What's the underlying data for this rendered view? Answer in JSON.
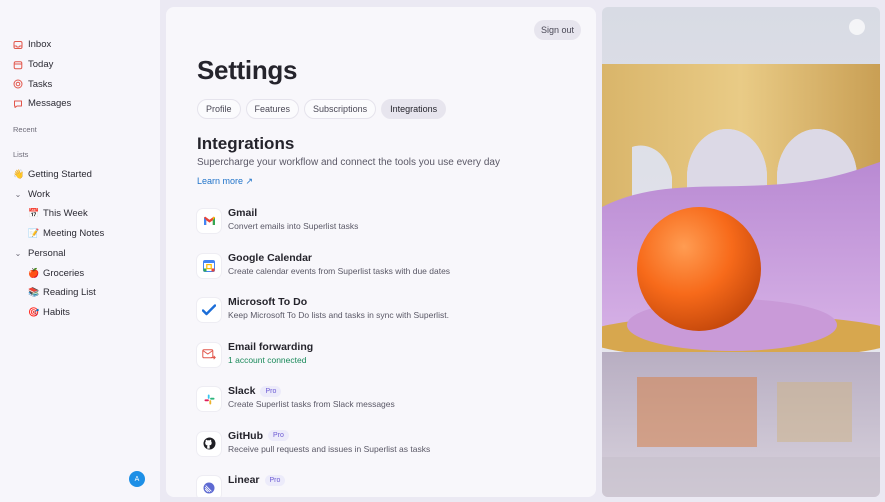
{
  "sidebar": {
    "nav": [
      {
        "label": "Inbox",
        "icon": "inbox-icon"
      },
      {
        "label": "Today",
        "icon": "calendar-icon"
      },
      {
        "label": "Tasks",
        "icon": "tasks-icon"
      },
      {
        "label": "Messages",
        "icon": "messages-icon"
      }
    ],
    "recent_label": "Recent",
    "lists_label": "Lists",
    "getting_started": {
      "label": "Getting Started",
      "emoji": "👋"
    },
    "work": {
      "label": "Work",
      "items": [
        {
          "label": "This Week",
          "emoji": "📅"
        },
        {
          "label": "Meeting Notes",
          "emoji": "📝"
        }
      ]
    },
    "personal": {
      "label": "Personal",
      "items": [
        {
          "label": "Groceries",
          "emoji": "🍎"
        },
        {
          "label": "Reading List",
          "emoji": "📚"
        },
        {
          "label": "Habits",
          "emoji": "🎯"
        }
      ]
    },
    "avatar_initial": "A"
  },
  "main": {
    "signout_label": "Sign out",
    "title": "Settings",
    "tabs": [
      {
        "label": "Profile"
      },
      {
        "label": "Features"
      },
      {
        "label": "Subscriptions"
      },
      {
        "label": "Integrations",
        "active": true
      }
    ],
    "section_title": "Integrations",
    "section_desc": "Supercharge your workflow and connect the tools you use every day",
    "learn_more": "Learn more ↗",
    "pro_badge": "Pro",
    "integrations": [
      {
        "name": "Gmail",
        "desc": "Convert emails into Superlist tasks",
        "icon": "gmail-icon"
      },
      {
        "name": "Google Calendar",
        "desc": "Create calendar events from Superlist tasks with due dates",
        "icon": "google-calendar-icon"
      },
      {
        "name": "Microsoft To Do",
        "desc": "Keep Microsoft To Do lists and tasks in sync with Superlist.",
        "icon": "microsoft-todo-icon"
      },
      {
        "name": "Email forwarding",
        "desc": "1 account connected",
        "icon": "email-forward-icon",
        "connected": true
      },
      {
        "name": "Slack",
        "desc": "Create Superlist tasks from Slack messages",
        "icon": "slack-icon",
        "pro": true
      },
      {
        "name": "GitHub",
        "desc": "Receive pull requests and issues in Superlist as tasks",
        "icon": "github-icon",
        "pro": true
      },
      {
        "name": "Linear",
        "desc": "",
        "icon": "linear-icon",
        "pro": true
      }
    ]
  },
  "colors": {
    "accent_link": "#1f73c9",
    "connected_green": "#1a8a5a",
    "pro_badge": "#6c5ad4",
    "avatar": "#1d8fe6",
    "sidebar_icon_red": "#e2574c"
  }
}
